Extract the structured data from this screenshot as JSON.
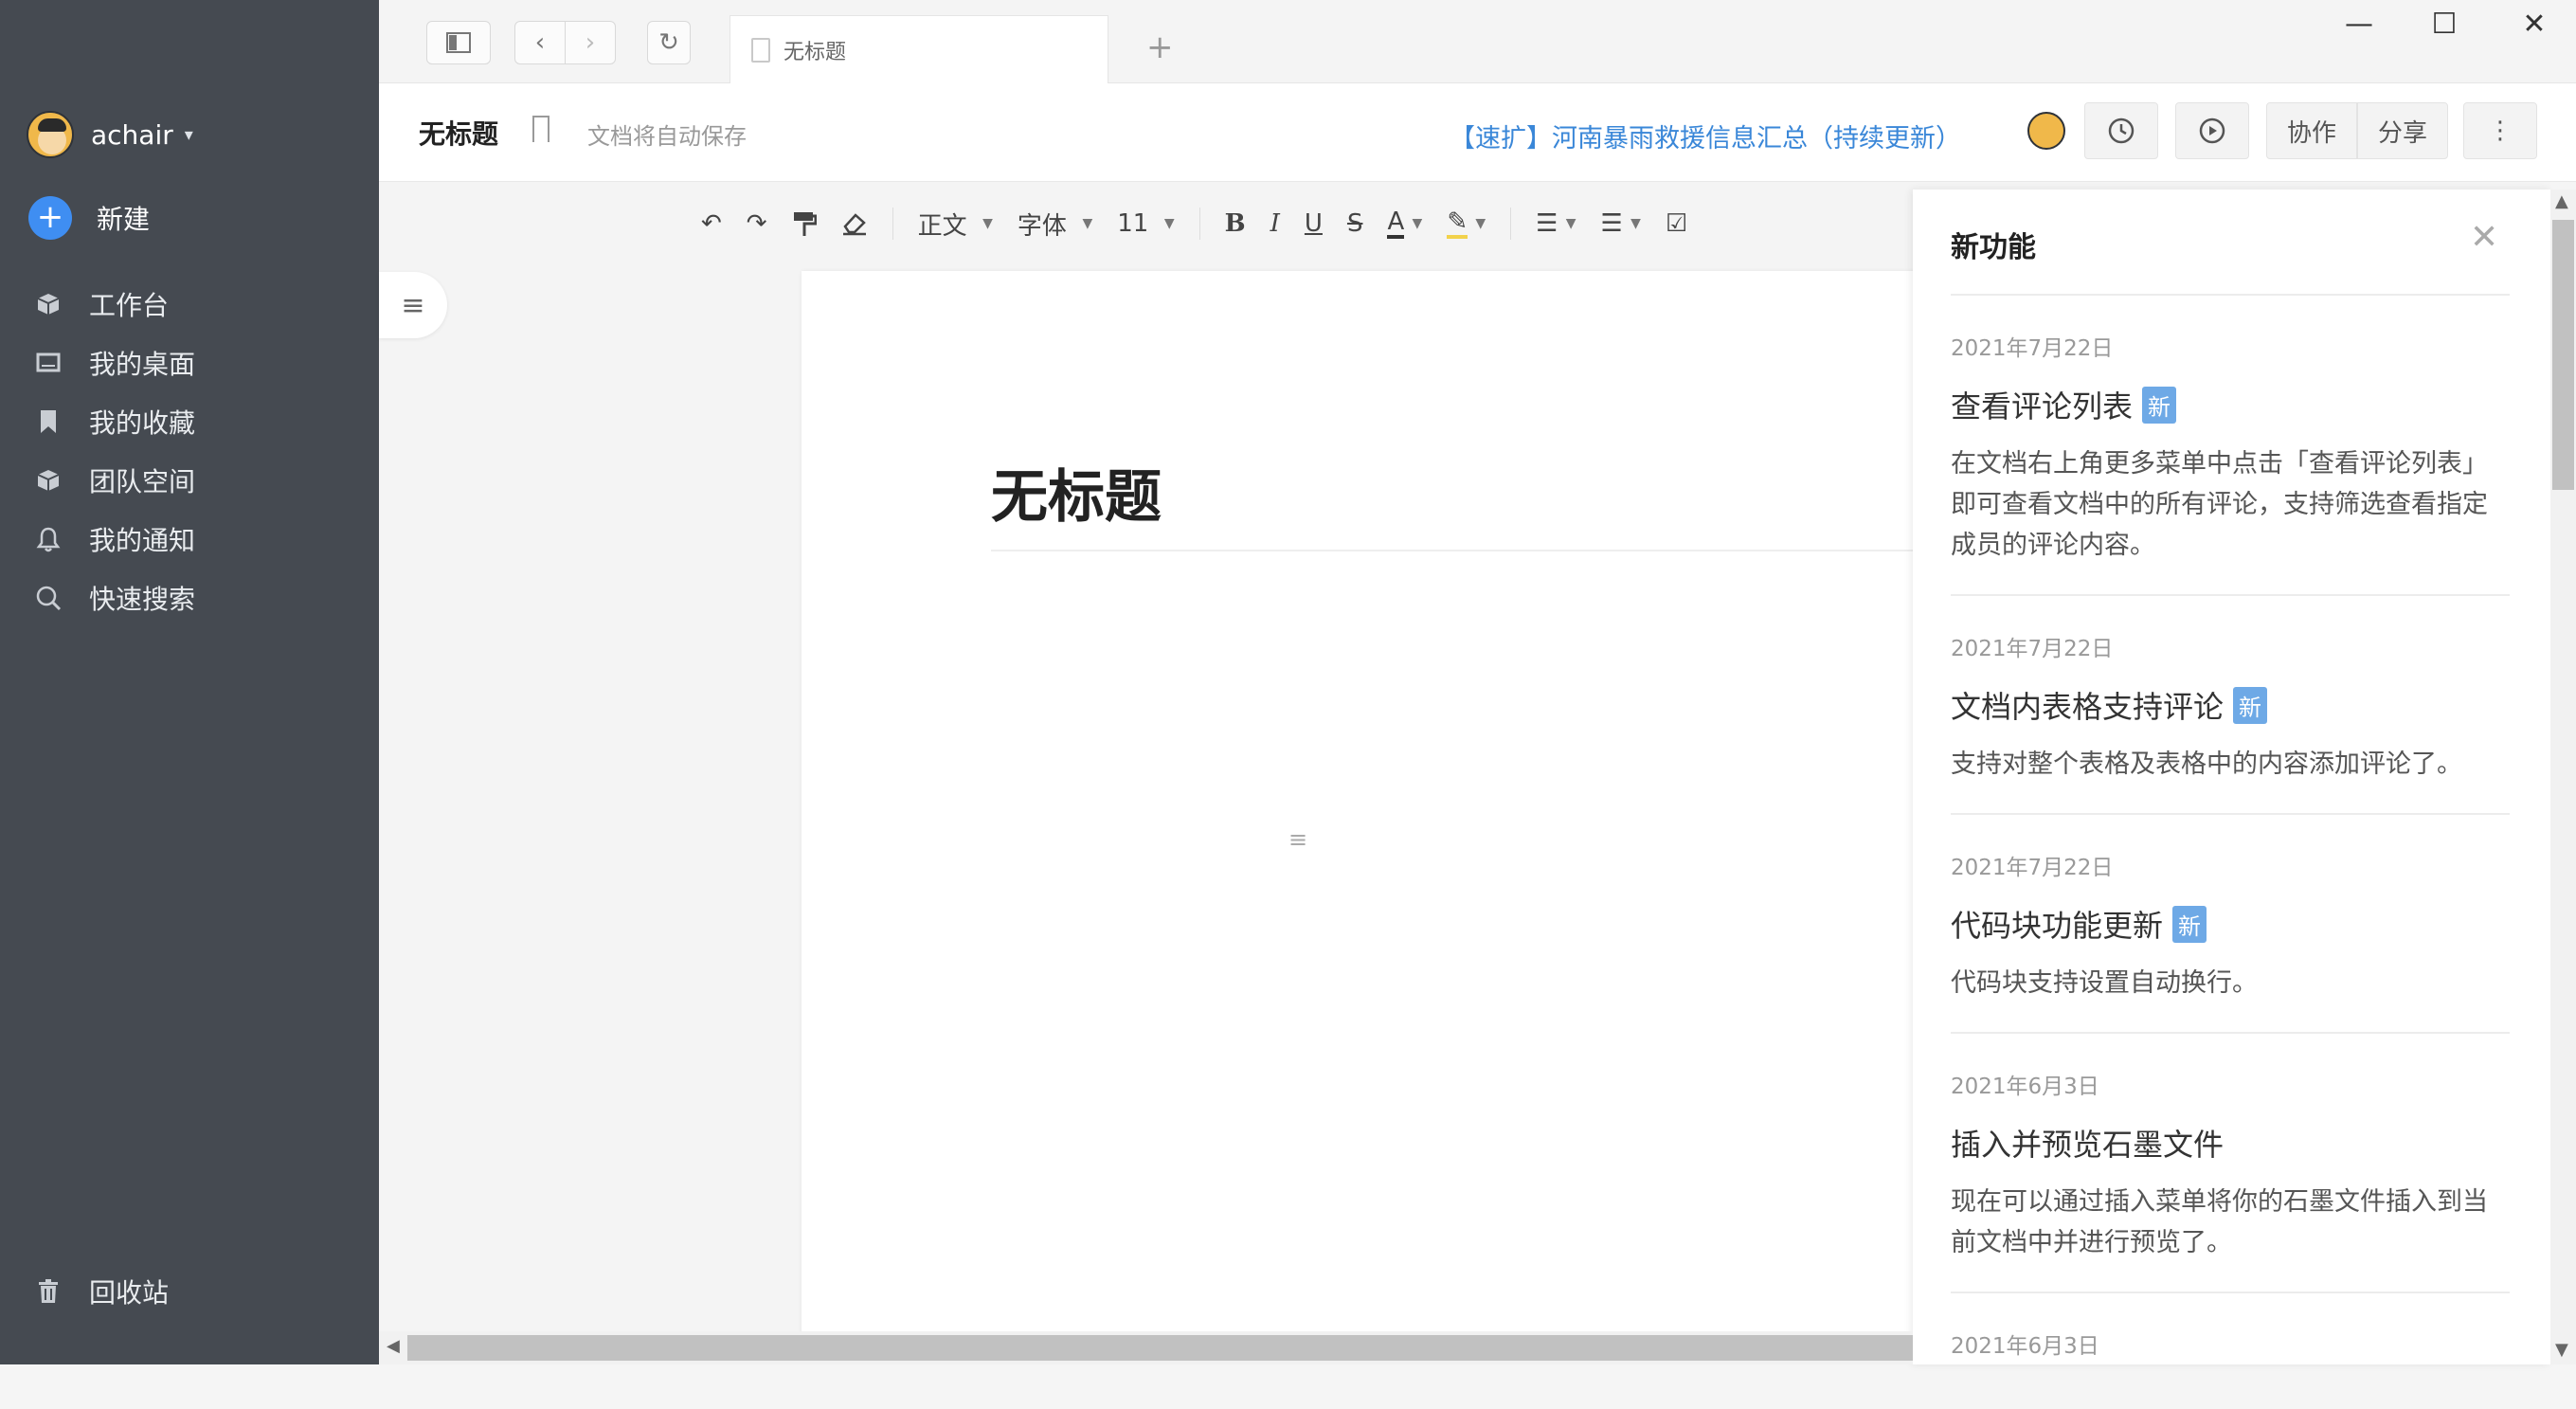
{
  "sidebar": {
    "username": "achair",
    "caret": "▾",
    "new_label": "新建",
    "items": [
      {
        "label": "工作台",
        "icon": "cube-icon"
      },
      {
        "label": "我的桌面",
        "icon": "desktop-icon"
      },
      {
        "label": "我的收藏",
        "icon": "bookmark-icon"
      },
      {
        "label": "团队空间",
        "icon": "team-cube-icon"
      },
      {
        "label": "我的通知",
        "icon": "bell-icon"
      },
      {
        "label": "快速搜索",
        "icon": "search-icon"
      }
    ],
    "trash_label": "回收站"
  },
  "tabbar": {
    "tab_title": "无标题"
  },
  "header": {
    "title": "无标题",
    "autosave": "文档将自动保存",
    "banner": "【速扩】河南暴雨救援信息汇总（持续更新）",
    "collab": "协作",
    "share": "分享"
  },
  "toolbar": {
    "style": "正文",
    "font": "字体",
    "size": "11"
  },
  "document": {
    "title": "无标题"
  },
  "panel": {
    "title": "新功能",
    "badge": "新",
    "items": [
      {
        "date": "2021年7月22日",
        "title": "查看评论列表",
        "desc": "在文档右上角更多菜单中点击「查看评论列表」即可查看文档中的所有评论，支持筛选查看指定成员的评论内容。"
      },
      {
        "date": "2021年7月22日",
        "title": "文档内表格支持评论",
        "desc": "支持对整个表格及表格中的内容添加评论了。"
      },
      {
        "date": "2021年7月22日",
        "title": "代码块功能更新",
        "desc": "代码块支持设置自动换行。"
      },
      {
        "date": "2021年6月3日",
        "title": "插入并预览石墨文件",
        "desc": "现在可以通过插入菜单将你的石墨文件插入到当前文档中并进行预览了。"
      },
      {
        "date": "2021年6月3日"
      }
    ]
  },
  "colors": {
    "sidebar_bg": "#454a51",
    "accent": "#3f8ef2",
    "badge": "#6ea9e6",
    "link": "#3a87d8"
  }
}
